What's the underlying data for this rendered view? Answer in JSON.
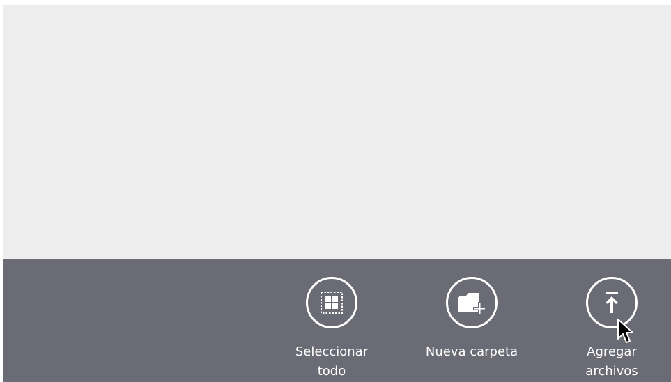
{
  "app_bar": {
    "commands": [
      {
        "label": "Seleccionar\ntodo",
        "icon": "select-all-icon"
      },
      {
        "label": "Nueva carpeta",
        "icon": "new-folder-icon"
      },
      {
        "label": "Agregar\narchivos",
        "icon": "upload-icon"
      }
    ]
  },
  "colors": {
    "content_background": "#ededed",
    "app_bar_background": "#6a6b74",
    "foreground": "#ffffff"
  }
}
